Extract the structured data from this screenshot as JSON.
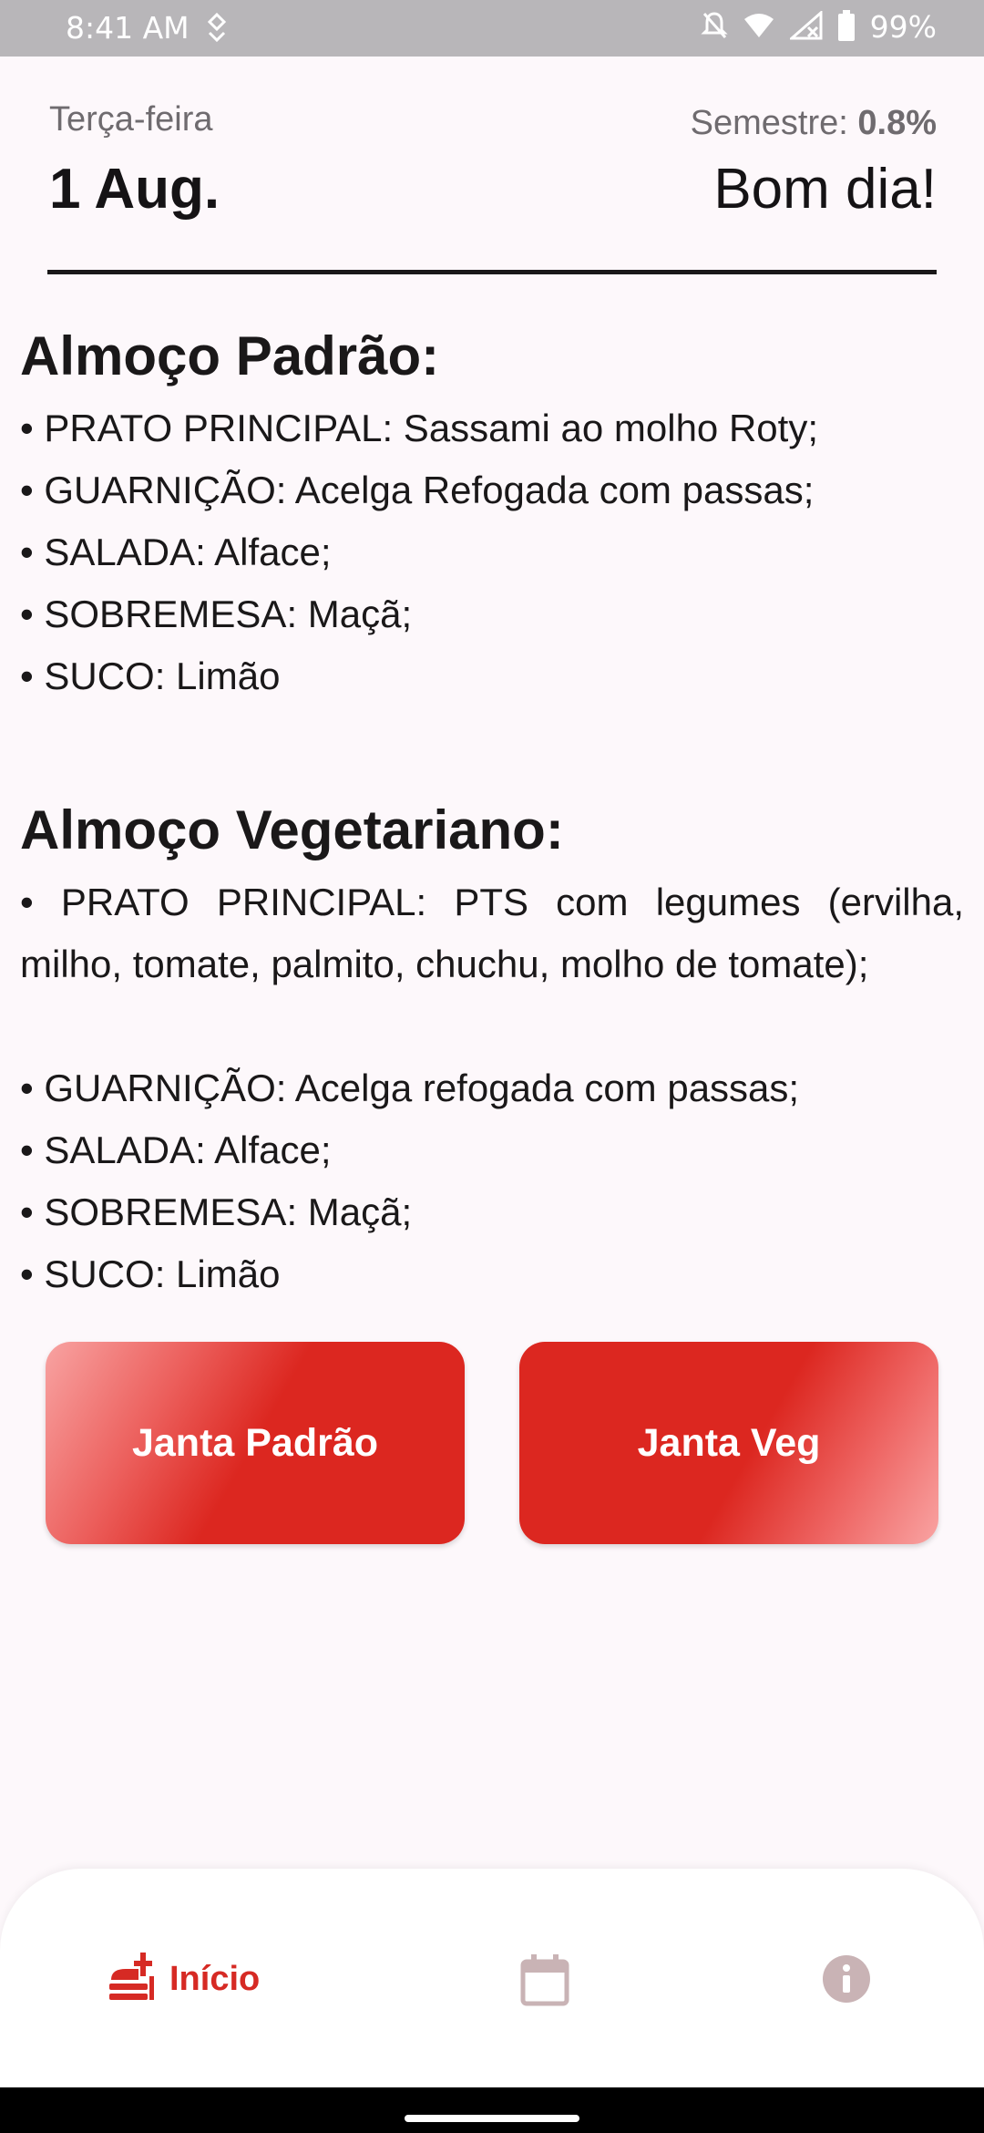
{
  "status_bar": {
    "time": "8:41 AM",
    "battery": "99%"
  },
  "header": {
    "weekday": "Terça-feira",
    "date": "1 Aug.",
    "semester_label": "Semestre:",
    "semester_value": "0.8%",
    "greeting": "Bom dia!"
  },
  "lunch_standard": {
    "title": "Almoço Padrão:",
    "items": [
      "• PRATO PRINCIPAL: Sassami ao molho Roty;",
      "• GUARNIÇÃO: Acelga Refogada com passas;",
      "• SALADA: Alface;",
      "• SOBREMESA: Maçã;",
      "• SUCO: Limão"
    ]
  },
  "lunch_vegetarian": {
    "title": "Almoço Vegetariano:",
    "items": [
      "• PRATO PRINCIPAL: PTS com legumes (ervilha, milho, tomate, palmito, chuchu, molho de tomate);",
      "• GUARNIÇÃO: Acelga refogada com passas;",
      "• SALADA: Alface;",
      "• SOBREMESA: Maçã;",
      "• SUCO: Limão"
    ]
  },
  "buttons": {
    "dinner_standard": "Janta Padrão",
    "dinner_veg": "Janta Veg"
  },
  "nav": {
    "home_label": "Início",
    "home_icon": "food-tray-icon",
    "calendar_icon": "calendar-icon",
    "info_icon": "info-icon",
    "active_color": "#d62a24",
    "inactive_color": "#c9b3b5"
  }
}
